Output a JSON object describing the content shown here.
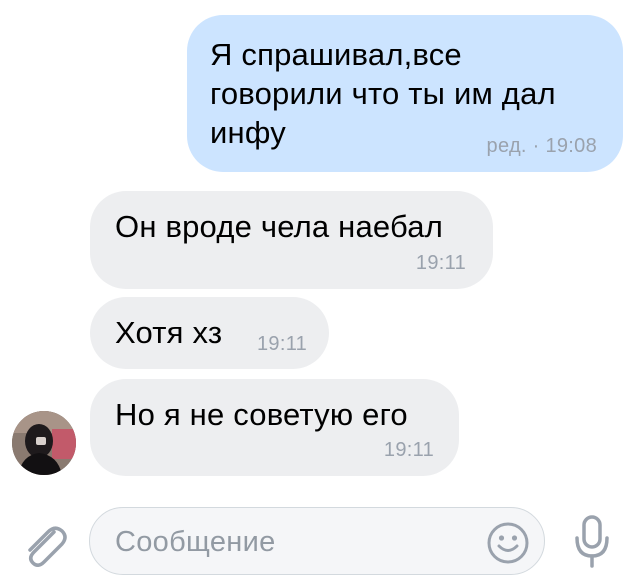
{
  "messages": [
    {
      "direction": "outgoing",
      "lines": [
        "Я спрашивал,все",
        "говорили что ты им дал",
        "инфу"
      ],
      "time": "ред. · 19:08"
    },
    {
      "direction": "incoming",
      "text": "Он вроде чела наебал",
      "time": "19:11"
    },
    {
      "direction": "incoming",
      "text": "Хотя хз",
      "time": "19:11"
    },
    {
      "direction": "incoming",
      "text": "Но я не советую его",
      "time": "19:11"
    }
  ],
  "composer": {
    "placeholder": "Сообщение",
    "attach_icon": "paperclip-icon",
    "emoji_icon": "smiley-icon",
    "mic_icon": "microphone-icon"
  },
  "colors": {
    "outgoing_bubble": "#cce4ff",
    "incoming_bubble": "#edeef0",
    "time_text": "#9aa2ad",
    "icon_gray": "#9aa2ad"
  }
}
